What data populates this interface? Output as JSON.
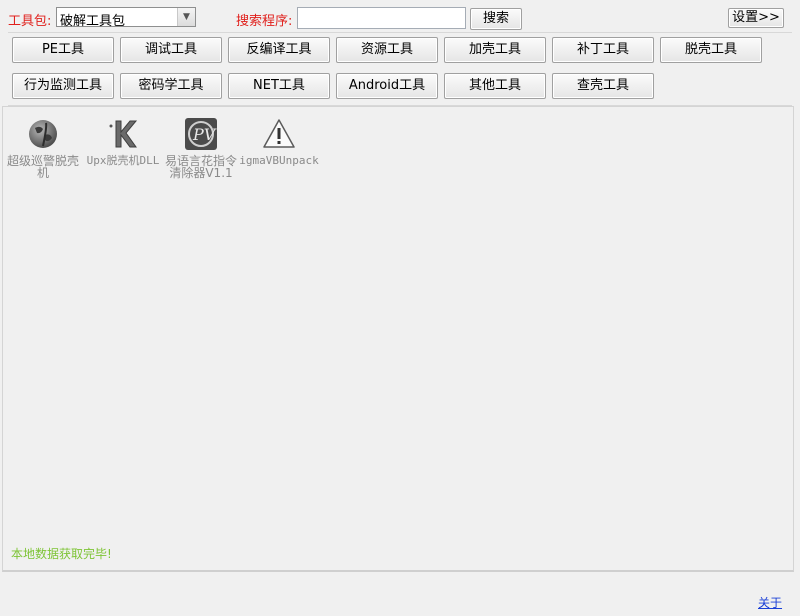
{
  "toolbar": {
    "toolkit_label": "工具包:",
    "toolkit_selected": "破解工具包",
    "search_label": "搜索程序:",
    "search_value": "",
    "search_button": "搜索",
    "settings_button": "设置>>"
  },
  "categories": [
    {
      "label": "PE工具"
    },
    {
      "label": "调试工具"
    },
    {
      "label": "反编译工具"
    },
    {
      "label": "资源工具"
    },
    {
      "label": "加壳工具"
    },
    {
      "label": "补丁工具"
    },
    {
      "label": "脱壳工具"
    },
    {
      "label": "行为监测工具"
    },
    {
      "label": "密码学工具"
    },
    {
      "label": "NET工具"
    },
    {
      "label": "Android工具"
    },
    {
      "label": "其他工具"
    },
    {
      "label": "查壳工具"
    }
  ],
  "tools": [
    {
      "name": "超级巡警脱壳机",
      "icon": "globe-icon"
    },
    {
      "name": "Upx脱壳机DLL",
      "icon": "k-logo-icon"
    },
    {
      "name": "易语言花指令清除器V1.1",
      "icon": "pv-logo-icon"
    },
    {
      "name": "igmaVBUnpack",
      "icon": "warning-icon"
    }
  ],
  "status": "本地数据获取完毕!",
  "footer": {
    "about": "关于"
  },
  "colors": {
    "label_red": "#e0201c",
    "status_green": "#7ec436",
    "link_blue": "#1a3fd6"
  }
}
